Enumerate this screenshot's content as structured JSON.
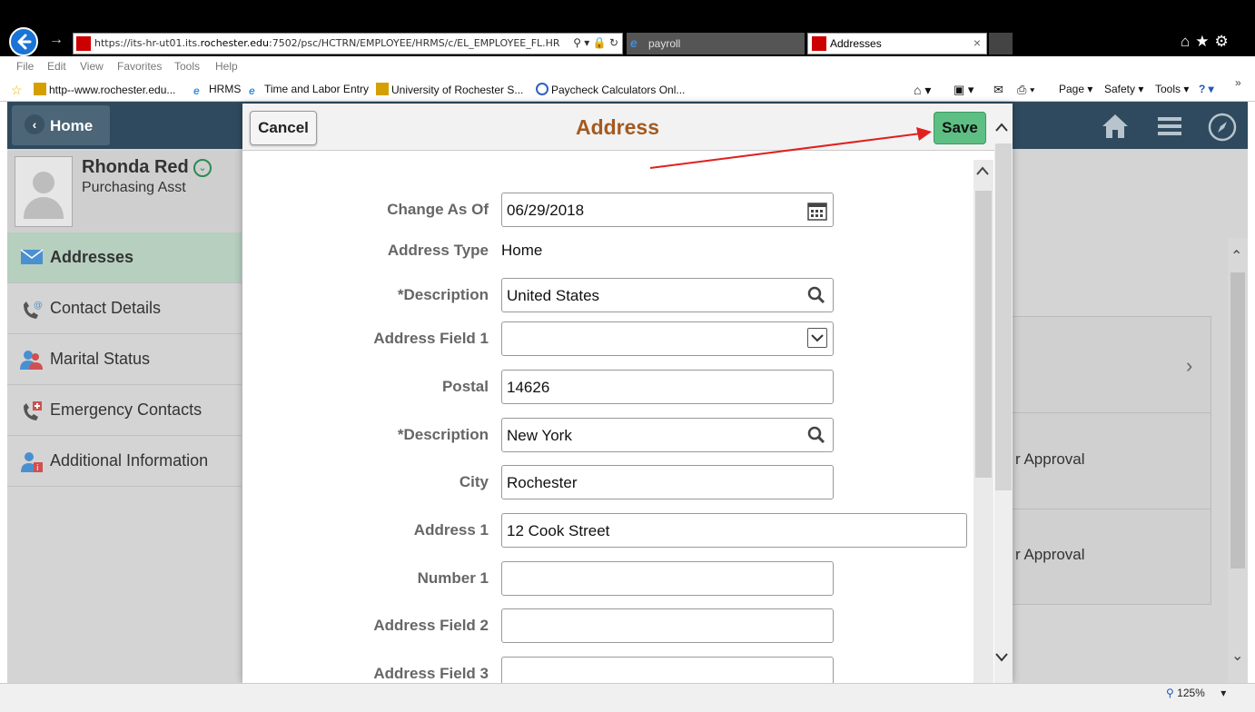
{
  "browser": {
    "url_prefix": "https://its-hr-ut01.its.",
    "url_domain": "rochester.edu",
    "url_suffix": ":7502/psc/HCTRN/EMPLOYEE/HRMS/c/EL_EMPLOYEE_FL.HR",
    "url_controls": "⚲ ▾ 🔒 ↻",
    "tabs": [
      {
        "label": "payroll"
      },
      {
        "label": "Addresses"
      }
    ],
    "tab_close": "×",
    "menu": [
      "File",
      "Edit",
      "View",
      "Favorites",
      "Tools",
      "Help"
    ],
    "favorites": [
      "http--www.rochester.edu...",
      "HRMS",
      "Time and Labor Entry",
      "University of Rochester  S...",
      "Paycheck Calculators  Onl..."
    ],
    "commands": [
      "Page ▾",
      "Safety ▾",
      "Tools ▾"
    ],
    "zoom": "125%",
    "overflow": "»"
  },
  "app": {
    "home_label": "Home",
    "person": {
      "name": "Rhonda Red",
      "title": "Purchasing Asst"
    },
    "nav": [
      {
        "label": "Addresses",
        "icon": "envelope-icon"
      },
      {
        "label": "Contact Details",
        "icon": "phone-at-icon"
      },
      {
        "label": "Marital Status",
        "icon": "people-icon"
      },
      {
        "label": "Emergency Contacts",
        "icon": "phone-plus-icon"
      },
      {
        "label": "Additional Information",
        "icon": "person-info-icon"
      }
    ],
    "right_panel": {
      "row1": "r Approval",
      "row2": "r Approval"
    }
  },
  "modal": {
    "title": "Address",
    "cancel_label": "Cancel",
    "save_label": "Save",
    "fields": {
      "change_as_of": {
        "label": "Change As Of",
        "value": "06/29/2018"
      },
      "address_type": {
        "label": "Address Type",
        "value": "Home"
      },
      "description1": {
        "label": "*Description",
        "value": "United States"
      },
      "address_field1": {
        "label": "Address Field 1",
        "value": ""
      },
      "postal": {
        "label": "Postal",
        "value": "14626"
      },
      "description2": {
        "label": "*Description",
        "value": "New York"
      },
      "city": {
        "label": "City",
        "value": "Rochester"
      },
      "address1": {
        "label": "Address 1",
        "value": "12 Cook Street"
      },
      "number1": {
        "label": "Number 1",
        "value": ""
      },
      "address_field2": {
        "label": "Address Field 2",
        "value": ""
      },
      "address_field3": {
        "label": "Address Field 3",
        "value": ""
      }
    }
  },
  "colors": {
    "save_green": "#5dbf84",
    "title_brown": "#a45a1f",
    "header_navy": "#2f4a5e",
    "annotation_red": "#e02020",
    "active_nav": "#b6cfbf"
  }
}
